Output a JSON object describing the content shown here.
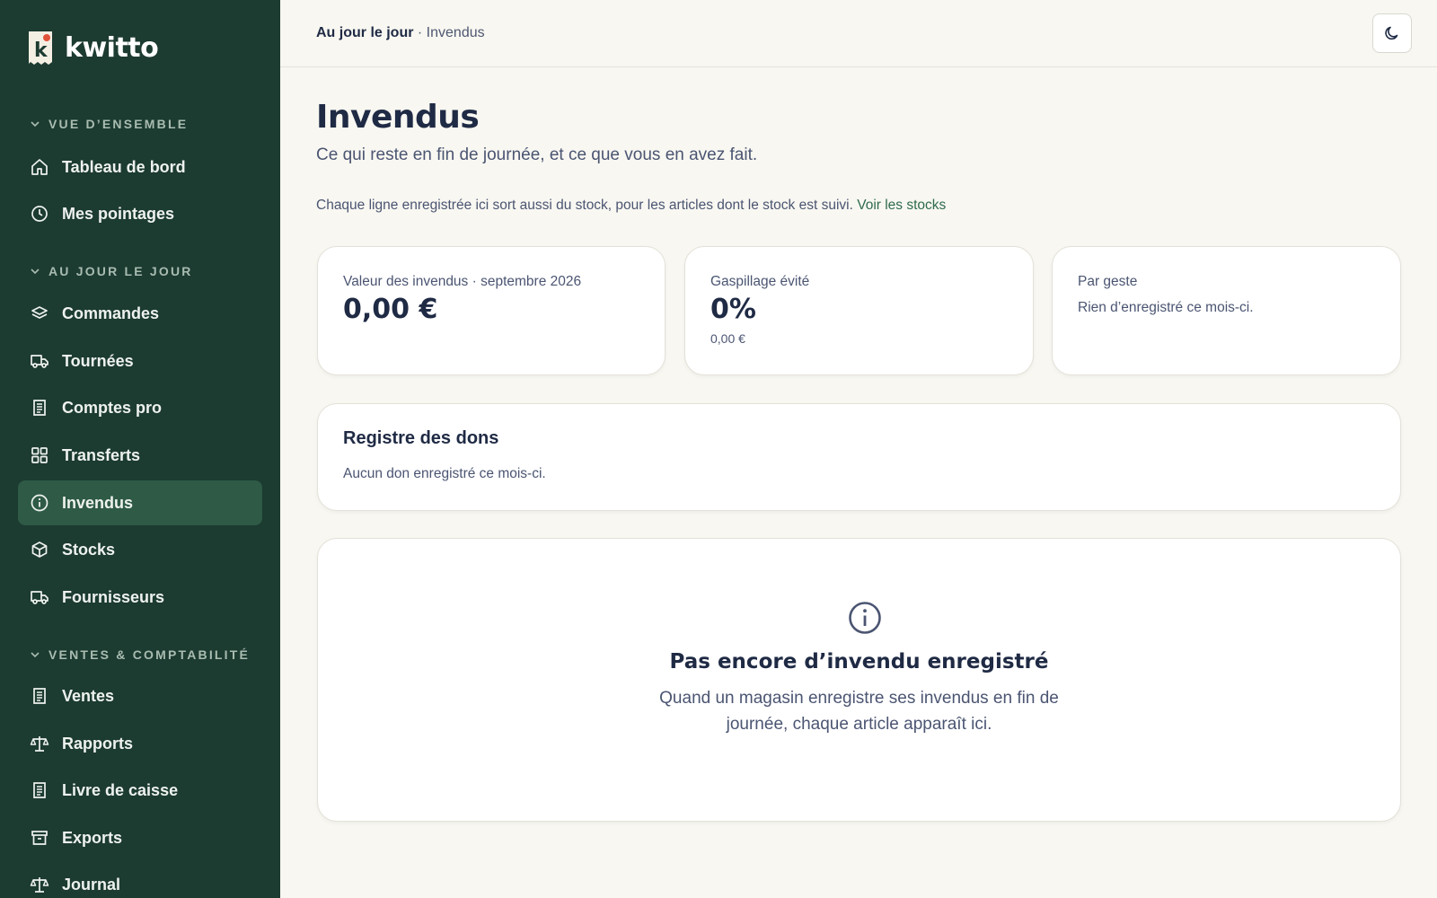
{
  "brand": {
    "name": "kwitto",
    "logo_letter": "k"
  },
  "sidebar": {
    "sections": [
      {
        "label": "VUE D’ENSEMBLE",
        "items": [
          {
            "label": "Tableau de bord",
            "icon": "home-icon"
          },
          {
            "label": "Mes pointages",
            "icon": "clock-icon"
          }
        ]
      },
      {
        "label": "AU JOUR LE JOUR",
        "items": [
          {
            "label": "Commandes",
            "icon": "layers-icon"
          },
          {
            "label": "Tournées",
            "icon": "truck-icon"
          },
          {
            "label": "Comptes pro",
            "icon": "receipt-icon"
          },
          {
            "label": "Transferts",
            "icon": "grid-icon"
          },
          {
            "label": "Invendus",
            "icon": "info-icon",
            "active": true
          },
          {
            "label": "Stocks",
            "icon": "box-icon"
          },
          {
            "label": "Fournisseurs",
            "icon": "truck-icon"
          }
        ]
      },
      {
        "label": "VENTES & COMPTABILITÉ",
        "items": [
          {
            "label": "Ventes",
            "icon": "receipt-icon"
          },
          {
            "label": "Rapports",
            "icon": "scale-icon"
          },
          {
            "label": "Livre de caisse",
            "icon": "receipt-icon"
          },
          {
            "label": "Exports",
            "icon": "archive-icon"
          },
          {
            "label": "Journal",
            "icon": "scale-icon"
          }
        ]
      }
    ]
  },
  "header": {
    "breadcrumb_parent": "Au jour le jour",
    "breadcrumb_separator": " · ",
    "breadcrumb_current": "Invendus",
    "theme_toggle_icon": "moon-icon"
  },
  "page": {
    "title": "Invendus",
    "subtitle": "Ce qui reste en fin de journée, et ce que vous en avez fait.",
    "info_text": "Chaque ligne enregistrée ici sort aussi du stock, pour les articles dont le stock est suivi. ",
    "info_link": "Voir les stocks"
  },
  "stats": {
    "value": {
      "label": "Valeur des invendus · septembre 2026",
      "value": "0,00 €"
    },
    "waste": {
      "label": "Gaspillage évité",
      "value": "0%",
      "sub": "0,00 €"
    },
    "by_action": {
      "label": "Par geste",
      "note": "Rien d’enregistré ce mois-ci."
    }
  },
  "donations": {
    "title": "Registre des dons",
    "text": "Aucun don enregistré ce mois-ci."
  },
  "empty_state": {
    "icon": "info-icon",
    "title": "Pas encore d’invendu enregistré",
    "text": "Quand un magasin enregistre ses invendus en fin de journée, chaque article apparaît ici."
  },
  "colors": {
    "sidebar_bg": "#1c3b31",
    "sidebar_active": "#2e5a46",
    "page_bg": "#f8f7f1",
    "text_primary": "#1f2a44",
    "link": "#2f6b4d",
    "logo_accent": "#e0523a"
  }
}
